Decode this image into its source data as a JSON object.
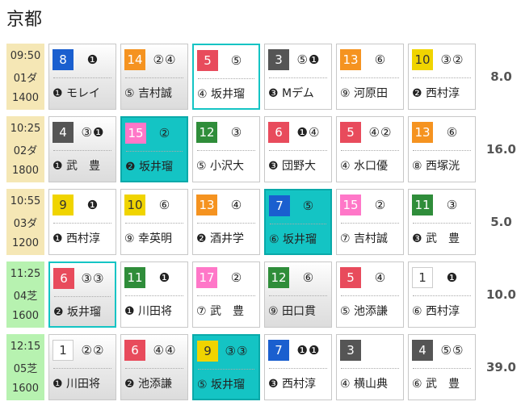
{
  "page": {
    "title": "京都"
  },
  "colors": {
    "1": "#ffffff",
    "2": "#555555",
    "3": "#e84b5c",
    "4": "#1a5fcf",
    "5": "#e8d100",
    "6": "#2f8d3a",
    "7": "#f59320",
    "8": "#ff77c8"
  },
  "races": [
    {
      "time": "09:50",
      "race": "01ダ",
      "dist": "1400",
      "track": "dirt",
      "odds": "8.0",
      "entries": [
        {
          "num": "8",
          "gate": "4",
          "marks": "❶",
          "jockey": "❶ モレイ",
          "style": "gray"
        },
        {
          "num": "14",
          "gate": "7",
          "marks": "②④",
          "jockey": "⑤ 吉村誠",
          "style": "gray"
        },
        {
          "num": "5",
          "gate": "3",
          "marks": "⑤",
          "jockey": "④ 坂井瑠",
          "style": "hl-out"
        },
        {
          "num": "3",
          "gate": "2",
          "marks": "⑤❶",
          "jockey": "❸ Mデム",
          "style": "plain"
        },
        {
          "num": "13",
          "gate": "7",
          "marks": "⑥",
          "jockey": "⑨ 河原田",
          "style": "plain"
        },
        {
          "num": "10",
          "gate": "5",
          "marks": "③②",
          "jockey": "❷ 西村淳",
          "style": "plain"
        }
      ]
    },
    {
      "time": "10:25",
      "race": "02ダ",
      "dist": "1800",
      "track": "dirt",
      "odds": "16.0",
      "entries": [
        {
          "num": "4",
          "gate": "2",
          "marks": "③❶",
          "jockey": "❶ 武　豊",
          "style": "gray"
        },
        {
          "num": "15",
          "gate": "8",
          "marks": "②",
          "jockey": "❷ 坂井瑠",
          "style": "hl"
        },
        {
          "num": "12",
          "gate": "6",
          "marks": "③",
          "jockey": "⑤ 小沢大",
          "style": "plain"
        },
        {
          "num": "6",
          "gate": "3",
          "marks": "❶④",
          "jockey": "❸ 団野大",
          "style": "plain"
        },
        {
          "num": "5",
          "gate": "3",
          "marks": "④②",
          "jockey": "④ 水口優",
          "style": "plain"
        },
        {
          "num": "13",
          "gate": "7",
          "marks": "⑥",
          "jockey": "⑧ 西塚洸",
          "style": "plain"
        }
      ]
    },
    {
      "time": "10:55",
      "race": "03ダ",
      "dist": "1200",
      "track": "dirt",
      "odds": "5.0",
      "entries": [
        {
          "num": "9",
          "gate": "5",
          "marks": "❶",
          "jockey": "❶ 西村淳",
          "style": "plain"
        },
        {
          "num": "10",
          "gate": "5",
          "marks": "⑥",
          "jockey": "⑨ 幸英明",
          "style": "plain"
        },
        {
          "num": "13",
          "gate": "7",
          "marks": "④",
          "jockey": "❷ 酒井学",
          "style": "plain"
        },
        {
          "num": "7",
          "gate": "4",
          "marks": "⑤",
          "jockey": "⑥ 坂井瑠",
          "style": "hl"
        },
        {
          "num": "15",
          "gate": "8",
          "marks": "②",
          "jockey": "⑦ 吉村誠",
          "style": "plain"
        },
        {
          "num": "11",
          "gate": "6",
          "marks": "③",
          "jockey": "❸ 武　豊",
          "style": "plain"
        }
      ]
    },
    {
      "time": "11:25",
      "race": "04芝",
      "dist": "1600",
      "track": "turf",
      "odds": "10.0",
      "entries": [
        {
          "num": "6",
          "gate": "3",
          "marks": "③③",
          "jockey": "❷ 坂井瑠",
          "style": "gray hl-out"
        },
        {
          "num": "11",
          "gate": "6",
          "marks": "❶",
          "jockey": "❶ 川田将",
          "style": "plain"
        },
        {
          "num": "17",
          "gate": "8",
          "marks": "②",
          "jockey": "⑦ 武　豊",
          "style": "plain"
        },
        {
          "num": "12",
          "gate": "6",
          "marks": "⑥",
          "jockey": "⑨ 田口貫",
          "style": "gray"
        },
        {
          "num": "5",
          "gate": "3",
          "marks": "④",
          "jockey": "⑤ 池添謙",
          "style": "plain"
        },
        {
          "num": "1",
          "gate": "1",
          "marks": "❶",
          "jockey": "⑥ 西村淳",
          "style": "plain"
        }
      ]
    },
    {
      "time": "12:15",
      "race": "05芝",
      "dist": "1600",
      "track": "turf",
      "odds": "39.0",
      "entries": [
        {
          "num": "1",
          "gate": "1",
          "marks": "②②",
          "jockey": "❶ 川田将",
          "style": "gray"
        },
        {
          "num": "6",
          "gate": "3",
          "marks": "④④",
          "jockey": "❷ 池添謙",
          "style": "gray"
        },
        {
          "num": "9",
          "gate": "5",
          "marks": "③③",
          "jockey": "⑤ 坂井瑠",
          "style": "hl"
        },
        {
          "num": "7",
          "gate": "4",
          "marks": "❶❶",
          "jockey": "❸ 西村淳",
          "style": "plain"
        },
        {
          "num": "3",
          "gate": "2",
          "marks": "",
          "jockey": "④ 横山典",
          "style": "plain"
        },
        {
          "num": "4",
          "gate": "2",
          "marks": "⑤⑤",
          "jockey": "⑥ 武　豊",
          "style": "plain"
        }
      ]
    }
  ]
}
